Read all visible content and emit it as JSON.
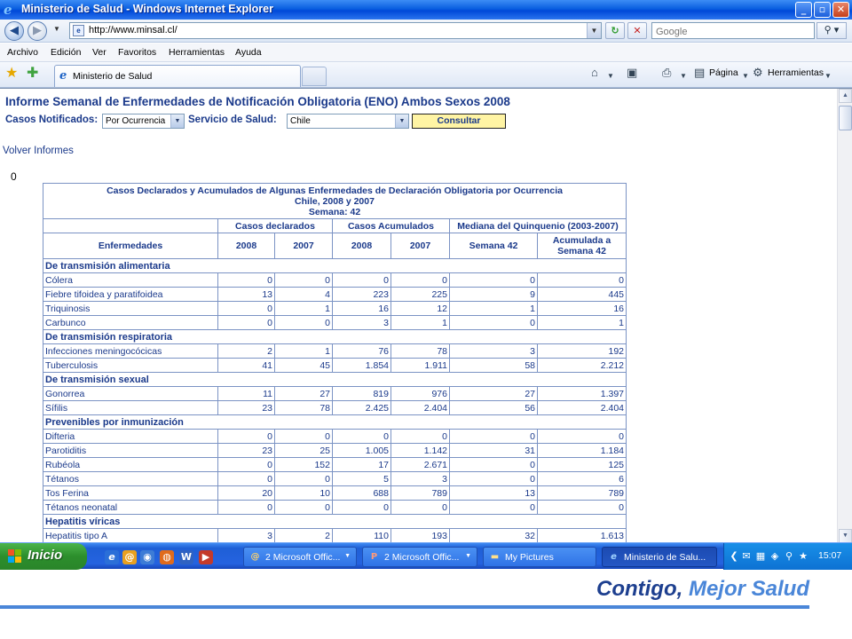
{
  "window": {
    "title": "Ministerio de Salud - Windows Internet Explorer",
    "minimize_glyph": "_",
    "maximize_glyph": "▫",
    "close_glyph": "✕"
  },
  "address": {
    "url": "http://www.minsal.cl/",
    "search_placeholder": "Google"
  },
  "menu": {
    "items": [
      "Archivo",
      "Edición",
      "Ver",
      "Favoritos",
      "Herramientas",
      "Ayuda"
    ]
  },
  "tabs": {
    "active_label": "Ministerio de Salud",
    "tools": [
      "Página",
      "Herramientas"
    ]
  },
  "page": {
    "heading": "Informe Semanal de Enfermedades de Notificación Obligatoria (ENO) Ambos Sexos 2008",
    "casos_label": "Casos Notificados:",
    "casos_value": "Por Ocurrencia",
    "servicio_label": "Servicio de Salud:",
    "servicio_value": "Chile",
    "consultar": "Consultar",
    "volver": "Volver Informes",
    "zero": "0"
  },
  "table": {
    "caption_line1": "Casos Declarados y Acumulados de Algunas Enfermedades de Declaración Obligatoria por Ocurrencia",
    "caption_line2": "Chile, 2008 y 2007",
    "caption_line3": "Semana: 42",
    "group_headers": [
      "Casos declarados",
      "Casos Acumulados",
      "Mediana del Quinquenio (2003-2007)"
    ],
    "col_enfermedades": "Enfermedades",
    "sub_headers": [
      "2008",
      "2007",
      "2008",
      "2007",
      "Semana 42"
    ],
    "acumulada_line1": "Acumulada a",
    "acumulada_line2": "Semana 42",
    "rows": [
      {
        "section": "De transmisión alimentaria"
      },
      {
        "name": "Cólera",
        "v": [
          "0",
          "0",
          "0",
          "0",
          "0",
          "0"
        ]
      },
      {
        "name": "Fiebre tifoidea y paratifoidea",
        "v": [
          "13",
          "4",
          "223",
          "225",
          "9",
          "445"
        ]
      },
      {
        "name": "Triquinosis",
        "v": [
          "0",
          "1",
          "16",
          "12",
          "1",
          "16"
        ]
      },
      {
        "name": "Carbunco",
        "v": [
          "0",
          "0",
          "3",
          "1",
          "0",
          "1"
        ]
      },
      {
        "section": "De transmisión respiratoria"
      },
      {
        "name": "Infecciones meningocócicas",
        "v": [
          "2",
          "1",
          "76",
          "78",
          "3",
          "192"
        ]
      },
      {
        "name": "Tuberculosis",
        "v": [
          "41",
          "45",
          "1.854",
          "1.911",
          "58",
          "2.212"
        ]
      },
      {
        "section": "De transmisión sexual"
      },
      {
        "name": "Gonorrea",
        "v": [
          "11",
          "27",
          "819",
          "976",
          "27",
          "1.397"
        ]
      },
      {
        "name": "Sífilis",
        "v": [
          "23",
          "78",
          "2.425",
          "2.404",
          "56",
          "2.404"
        ]
      },
      {
        "section": "Prevenibles por inmunización"
      },
      {
        "name": "Difteria",
        "v": [
          "0",
          "0",
          "0",
          "0",
          "0",
          "0"
        ]
      },
      {
        "name": "Parotiditis",
        "v": [
          "23",
          "25",
          "1.005",
          "1.142",
          "31",
          "1.184"
        ]
      },
      {
        "name": "Rubéola",
        "v": [
          "0",
          "152",
          "17",
          "2.671",
          "0",
          "125"
        ]
      },
      {
        "name": "Tétanos",
        "v": [
          "0",
          "0",
          "5",
          "3",
          "0",
          "6"
        ]
      },
      {
        "name": "Tos Ferina",
        "v": [
          "20",
          "10",
          "688",
          "789",
          "13",
          "789"
        ]
      },
      {
        "name": "Tétanos neonatal",
        "v": [
          "0",
          "0",
          "0",
          "0",
          "0",
          "0"
        ]
      },
      {
        "section": "Hepatitis víricas"
      },
      {
        "name": "Hepatitis tipo A",
        "v": [
          "3",
          "2",
          "110",
          "193",
          "32",
          "1.613"
        ]
      }
    ]
  },
  "taskbar": {
    "start": "Inicio",
    "tasks": [
      {
        "label": "2 Microsoft Offic...",
        "icon": "outlook-icon",
        "dropdown": true
      },
      {
        "label": "2 Microsoft Offic...",
        "icon": "powerpoint-icon",
        "dropdown": true
      },
      {
        "label": "My Pictures",
        "icon": "folder-icon",
        "dropdown": false
      },
      {
        "label": "Ministerio de Salu...",
        "icon": "internet-explorer-icon",
        "dropdown": false,
        "active": true
      }
    ],
    "clock": "15:07"
  },
  "footer": {
    "slogan_part1": "Contigo,",
    "slogan_part2": "Mejor Salud"
  },
  "colors": {
    "link_blue": "#1b3a8b",
    "table_border": "#7b93c4",
    "consultar_bg": "#fff4a4",
    "taskbar_blue": "#2563e0",
    "start_green": "#2c8e2c",
    "slogan_accent": "#4a86d8"
  }
}
